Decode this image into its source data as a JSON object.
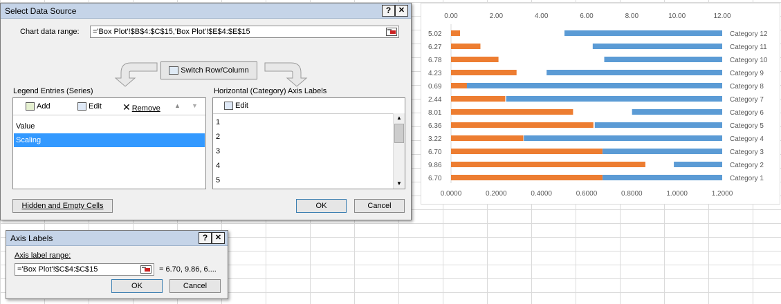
{
  "select_data_source": {
    "title": "Select Data Source",
    "help_label": "?",
    "close_label": "✕",
    "chart_data_range_label": "Chart data range:",
    "chart_data_range_value": "='Box Plot'!$B$4:$C$15,'Box Plot'!$E$4:$E$15",
    "switch_label": "Switch Row/Column",
    "legend_header": "Legend Entries (Series)",
    "legend_toolbar": {
      "add": "Add",
      "edit": "Edit",
      "remove": "Remove"
    },
    "series": [
      "Value",
      "Scaling"
    ],
    "axis_header": "Horizontal (Category) Axis Labels",
    "axis_edit": "Edit",
    "axis_items": [
      "1",
      "2",
      "3",
      "4",
      "5"
    ],
    "hidden_cells_label": "Hidden and Empty Cells",
    "ok_label": "OK",
    "cancel_label": "Cancel"
  },
  "axis_labels_dialog": {
    "title": "Axis Labels",
    "help_label": "?",
    "close_label": "✕",
    "range_label": "Axis label range:",
    "range_value": "='Box Plot'!$C$4:$C$15",
    "preview": "= 6.70, 9.86, 6....",
    "ok_label": "OK",
    "cancel_label": "Cancel"
  },
  "chart_data": {
    "type": "bar",
    "orientation": "horizontal",
    "stacked": false,
    "categories": [
      "Category 1",
      "Category 2",
      "Category 3",
      "Category 4",
      "Category 5",
      "Category 6",
      "Category 7",
      "Category 8",
      "Category 9",
      "Category 10",
      "Category 11",
      "Category 12"
    ],
    "left_axis_labels": [
      "6.70",
      "9.86",
      "6.70",
      "3.22",
      "6.36",
      "8.01",
      "2.44",
      "0.69",
      "4.23",
      "6.78",
      "6.27",
      "5.02"
    ],
    "top_axis_ticks": [
      "0.00",
      "2.00",
      "4.00",
      "6.00",
      "8.00",
      "10.00",
      "12.00"
    ],
    "top_axis_range": [
      0,
      12
    ],
    "bottom_axis_ticks": [
      "0.0000",
      "0.2000",
      "0.4000",
      "0.6000",
      "0.8000",
      "1.0000",
      "1.2000"
    ],
    "bottom_axis_range": [
      0,
      1.2
    ],
    "series": [
      {
        "values": [
          6.7,
          9.86,
          6.7,
          3.22,
          6.36,
          8.01,
          2.44,
          0.69,
          4.23,
          6.78,
          6.27,
          5.02
        ],
        "color": "#5b9bd5",
        "axis": "top",
        "draw": "from-value-to-max"
      },
      {
        "values": [
          0.67,
          0.86,
          0.67,
          0.32,
          0.63,
          0.54,
          0.24,
          0.07,
          0.29,
          0.21,
          0.13,
          0.04
        ],
        "color": "#ed7d31",
        "axis": "bottom",
        "draw": "from-zero"
      }
    ],
    "grid": false
  }
}
